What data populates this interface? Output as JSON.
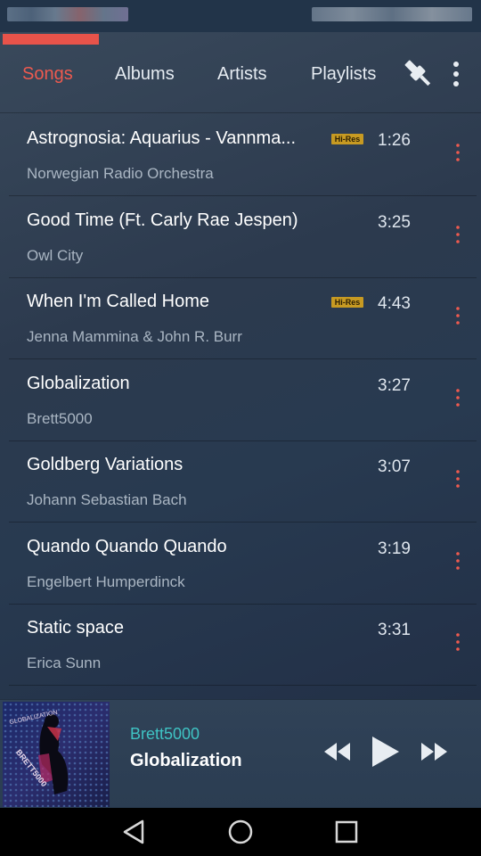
{
  "tabs": [
    {
      "label": "Songs"
    },
    {
      "label": "Albums"
    },
    {
      "label": "Artists"
    },
    {
      "label": "Playlists"
    }
  ],
  "songs": [
    {
      "title": "Astrognosia: Aquarius - Vannma...",
      "artist": "Norwegian Radio Orchestra",
      "duration": "1:26",
      "badge": "Hi-Res"
    },
    {
      "title": "Good Time (Ft. Carly Rae Jespen)",
      "artist": "Owl City",
      "duration": "3:25",
      "badge": ""
    },
    {
      "title": "When I'm Called Home",
      "artist": "Jenna Mammina & John R. Burr",
      "duration": "4:43",
      "badge": "Hi-Res"
    },
    {
      "title": "Globalization",
      "artist": "Brett5000",
      "duration": "3:27",
      "badge": ""
    },
    {
      "title": "Goldberg Variations",
      "artist": "Johann Sebastian Bach",
      "duration": "3:07",
      "badge": ""
    },
    {
      "title": "Quando Quando Quando",
      "artist": "Engelbert Humperdinck",
      "duration": "3:19",
      "badge": ""
    },
    {
      "title": "Static space",
      "artist": "Erica Sunn",
      "duration": "3:31",
      "badge": ""
    }
  ],
  "now_playing": {
    "artist": "Brett5000",
    "title": "Globalization",
    "art_text_top": "GLOBALIZATION",
    "art_text_bottom": "BRETT5000"
  },
  "icons": {
    "plugin": "plug-icon",
    "overflow": "more-vert-icon",
    "row_menu": "more-vert-icon",
    "prev": "rewind-icon",
    "play": "play-icon",
    "next": "fast-forward-icon",
    "nav_back": "back-triangle-icon",
    "nav_home": "home-circle-icon",
    "nav_recents": "recents-square-icon"
  },
  "colors": {
    "accent": "#ee5a4f",
    "artist_accent": "#3fc3c4",
    "hires_badge": "#c79a22",
    "background": "#2c3a4e"
  }
}
